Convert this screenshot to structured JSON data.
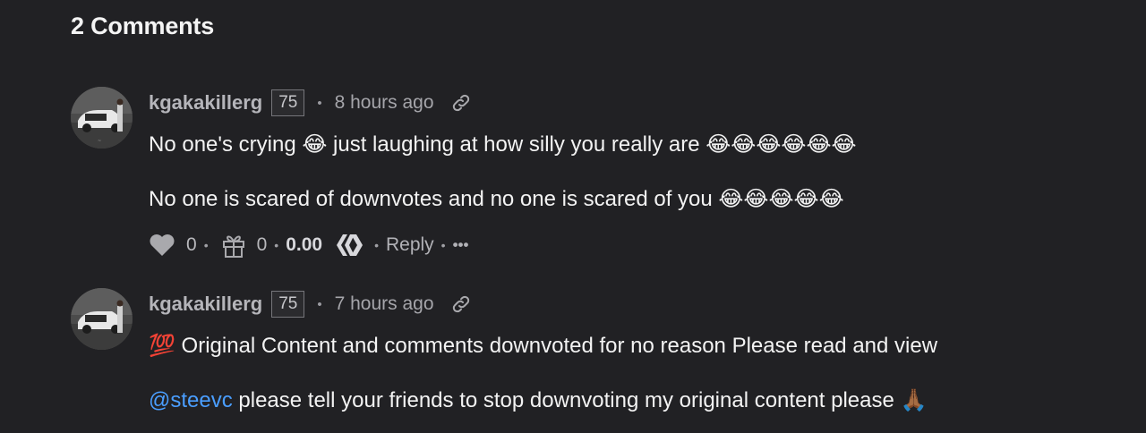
{
  "heading": "2 Comments",
  "comments": [
    {
      "author": "kgakakillerg",
      "reputation": "75",
      "time": "8 hours ago",
      "line1_a": "No one's crying ",
      "line1_emoji": "😂",
      "line1_b": " just laughing at how silly you really are ",
      "line1_trail": "😂😂😂😂😂😂",
      "line2_a": "No one is scared of downvotes and no one is scared of you ",
      "line2_trail": "😂😂😂😂😂",
      "votes": "0",
      "gifts": "0",
      "payout": "0.00",
      "reply_label": "Reply",
      "more_label": "•••"
    },
    {
      "author": "kgakakillerg",
      "reputation": "75",
      "time": "7 hours ago",
      "line1_emoji": "💯",
      "line1_b": " Original Content and comments downvoted for no reason Please read and view",
      "mention": "@steevc",
      "line2_a": " please tell your friends to stop downvoting my original content please ",
      "line2_trail": "🙏🏾"
    }
  ],
  "colors": {
    "background": "#212124",
    "mention": "#4a9eff",
    "text": "#f3f3f3",
    "muted": "#a9a9ad"
  },
  "icons": [
    "link-icon",
    "heart-icon",
    "gift-icon",
    "hive-icon",
    "more-icon"
  ]
}
